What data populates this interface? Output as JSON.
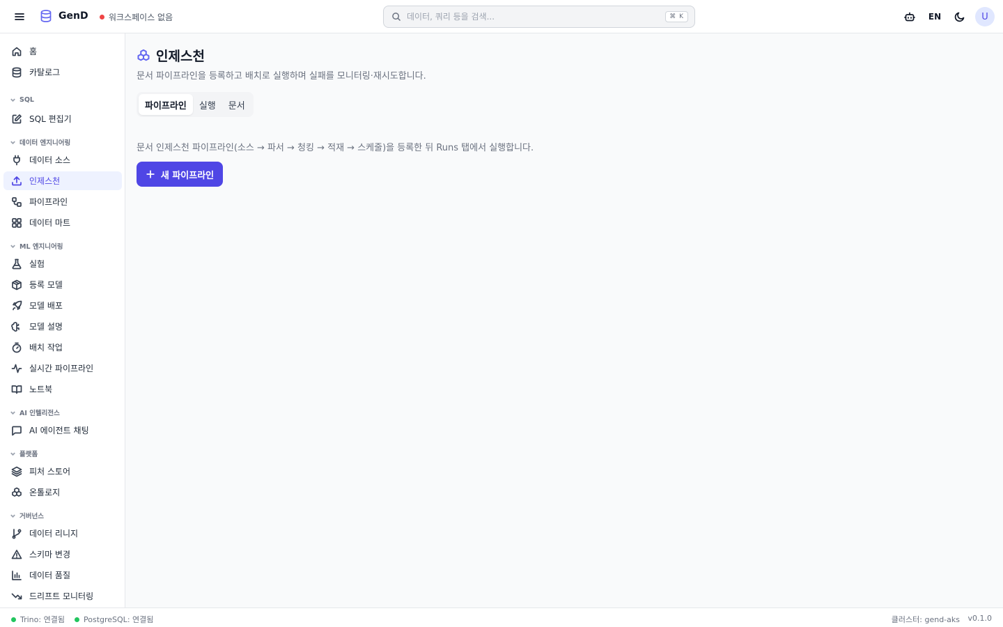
{
  "header": {
    "brand": "GenD",
    "workspace_status": "워크스페이스 없음",
    "search_placeholder": "데이터, 쿼리 등을 검색...",
    "search_shortcut": "⌘ K",
    "language": "EN",
    "avatar_initial": "U"
  },
  "sidebar": {
    "top": [
      {
        "label": "홈",
        "icon": "home-icon"
      },
      {
        "label": "카탈로그",
        "icon": "database-icon"
      }
    ],
    "sections": [
      {
        "title": "SQL",
        "items": [
          {
            "label": "SQL 편집기",
            "icon": "edit-icon"
          }
        ]
      },
      {
        "title": "데이터 엔지니어링",
        "items": [
          {
            "label": "데이터 소스",
            "icon": "plug-icon"
          },
          {
            "label": "인제스천",
            "icon": "upload-icon",
            "active": true
          },
          {
            "label": "파이프라인",
            "icon": "workflow-icon"
          },
          {
            "label": "데이터 마트",
            "icon": "grid-icon"
          }
        ]
      },
      {
        "title": "ML 엔지니어링",
        "items": [
          {
            "label": "실험",
            "icon": "flask-icon"
          },
          {
            "label": "등록 모델",
            "icon": "box-icon"
          },
          {
            "label": "모델 배포",
            "icon": "rocket-icon"
          },
          {
            "label": "모델 설명",
            "icon": "brain-icon"
          },
          {
            "label": "배치 작업",
            "icon": "timer-icon"
          },
          {
            "label": "실시간 파이프라인",
            "icon": "activity-icon"
          },
          {
            "label": "노트북",
            "icon": "book-icon"
          }
        ]
      },
      {
        "title": "AI 인텔리전스",
        "items": [
          {
            "label": "AI 에이전트 채팅",
            "icon": "chat-icon"
          }
        ]
      },
      {
        "title": "플랫폼",
        "items": [
          {
            "label": "피처 스토어",
            "icon": "layers-icon"
          },
          {
            "label": "온톨로지",
            "icon": "boxes-icon"
          }
        ]
      },
      {
        "title": "거버넌스",
        "items": [
          {
            "label": "데이터 리니지",
            "icon": "git-branch-icon"
          },
          {
            "label": "스키마 변경",
            "icon": "alert-triangle-icon"
          },
          {
            "label": "데이터 품질",
            "icon": "bar-chart-icon"
          },
          {
            "label": "드리프트 모니터링",
            "icon": "trending-down-icon"
          }
        ]
      }
    ]
  },
  "main": {
    "title": "인제스천",
    "subtitle": "문서 파이프라인을 등록하고 배치로 실행하며 실패를 모니터링·재시도합니다.",
    "tabs": [
      "파이프라인",
      "실행",
      "문서"
    ],
    "active_tab": "파이프라인",
    "description": "문서 인제스천 파이프라인(소스 → 파서 → 청킹 → 적재 → 스케줄)을 등록한 뒤 Runs 탭에서 실행합니다.",
    "new_button": "새 파이프라인"
  },
  "footer": {
    "trino_status": "Trino: 연결됨",
    "postgres_status": "PostgreSQL: 연결됨",
    "cluster": "클러스터: gend-aks",
    "version": "v0.1.0"
  },
  "colors": {
    "accent": "#4f46e5",
    "active_bg": "#eef2ff",
    "status_ok": "#22c55e",
    "status_error": "#ef4444"
  }
}
